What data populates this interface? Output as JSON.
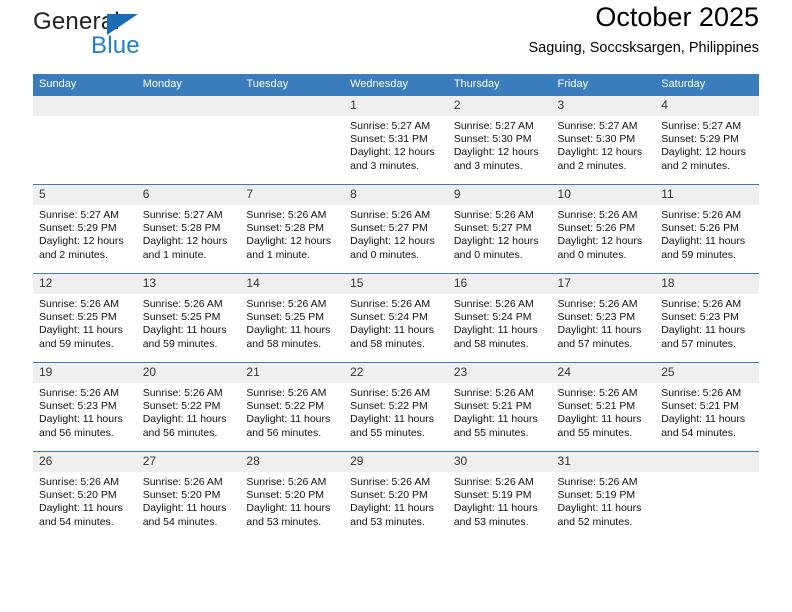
{
  "brand": {
    "line1": "General",
    "line2": "Blue",
    "triangle_color": "#1b6cb5",
    "blue_text_color": "#1b80d4"
  },
  "header": {
    "title": "October 2025",
    "subtitle": "Saguing, Soccsksargen, Philippines"
  },
  "theme": {
    "header_bar": "#3a7dbd",
    "day_band": "#efefef",
    "row_rule": "#3a7dbd"
  },
  "weekday_headers": [
    "Sunday",
    "Monday",
    "Tuesday",
    "Wednesday",
    "Thursday",
    "Friday",
    "Saturday"
  ],
  "weeks": [
    [
      {
        "day": "",
        "blank": true,
        "sunrise": "",
        "sunset": "",
        "daylight1": "",
        "daylight2": ""
      },
      {
        "day": "",
        "blank": true,
        "sunrise": "",
        "sunset": "",
        "daylight1": "",
        "daylight2": ""
      },
      {
        "day": "",
        "blank": true,
        "sunrise": "",
        "sunset": "",
        "daylight1": "",
        "daylight2": ""
      },
      {
        "day": "1",
        "sunrise": "Sunrise: 5:27 AM",
        "sunset": "Sunset: 5:31 PM",
        "daylight1": "Daylight: 12 hours",
        "daylight2": "and 3 minutes."
      },
      {
        "day": "2",
        "sunrise": "Sunrise: 5:27 AM",
        "sunset": "Sunset: 5:30 PM",
        "daylight1": "Daylight: 12 hours",
        "daylight2": "and 3 minutes."
      },
      {
        "day": "3",
        "sunrise": "Sunrise: 5:27 AM",
        "sunset": "Sunset: 5:30 PM",
        "daylight1": "Daylight: 12 hours",
        "daylight2": "and 2 minutes."
      },
      {
        "day": "4",
        "sunrise": "Sunrise: 5:27 AM",
        "sunset": "Sunset: 5:29 PM",
        "daylight1": "Daylight: 12 hours",
        "daylight2": "and 2 minutes."
      }
    ],
    [
      {
        "day": "5",
        "sunrise": "Sunrise: 5:27 AM",
        "sunset": "Sunset: 5:29 PM",
        "daylight1": "Daylight: 12 hours",
        "daylight2": "and 2 minutes."
      },
      {
        "day": "6",
        "sunrise": "Sunrise: 5:27 AM",
        "sunset": "Sunset: 5:28 PM",
        "daylight1": "Daylight: 12 hours",
        "daylight2": "and 1 minute."
      },
      {
        "day": "7",
        "sunrise": "Sunrise: 5:26 AM",
        "sunset": "Sunset: 5:28 PM",
        "daylight1": "Daylight: 12 hours",
        "daylight2": "and 1 minute."
      },
      {
        "day": "8",
        "sunrise": "Sunrise: 5:26 AM",
        "sunset": "Sunset: 5:27 PM",
        "daylight1": "Daylight: 12 hours",
        "daylight2": "and 0 minutes."
      },
      {
        "day": "9",
        "sunrise": "Sunrise: 5:26 AM",
        "sunset": "Sunset: 5:27 PM",
        "daylight1": "Daylight: 12 hours",
        "daylight2": "and 0 minutes."
      },
      {
        "day": "10",
        "sunrise": "Sunrise: 5:26 AM",
        "sunset": "Sunset: 5:26 PM",
        "daylight1": "Daylight: 12 hours",
        "daylight2": "and 0 minutes."
      },
      {
        "day": "11",
        "sunrise": "Sunrise: 5:26 AM",
        "sunset": "Sunset: 5:26 PM",
        "daylight1": "Daylight: 11 hours",
        "daylight2": "and 59 minutes."
      }
    ],
    [
      {
        "day": "12",
        "sunrise": "Sunrise: 5:26 AM",
        "sunset": "Sunset: 5:25 PM",
        "daylight1": "Daylight: 11 hours",
        "daylight2": "and 59 minutes."
      },
      {
        "day": "13",
        "sunrise": "Sunrise: 5:26 AM",
        "sunset": "Sunset: 5:25 PM",
        "daylight1": "Daylight: 11 hours",
        "daylight2": "and 59 minutes."
      },
      {
        "day": "14",
        "sunrise": "Sunrise: 5:26 AM",
        "sunset": "Sunset: 5:25 PM",
        "daylight1": "Daylight: 11 hours",
        "daylight2": "and 58 minutes."
      },
      {
        "day": "15",
        "sunrise": "Sunrise: 5:26 AM",
        "sunset": "Sunset: 5:24 PM",
        "daylight1": "Daylight: 11 hours",
        "daylight2": "and 58 minutes."
      },
      {
        "day": "16",
        "sunrise": "Sunrise: 5:26 AM",
        "sunset": "Sunset: 5:24 PM",
        "daylight1": "Daylight: 11 hours",
        "daylight2": "and 58 minutes."
      },
      {
        "day": "17",
        "sunrise": "Sunrise: 5:26 AM",
        "sunset": "Sunset: 5:23 PM",
        "daylight1": "Daylight: 11 hours",
        "daylight2": "and 57 minutes."
      },
      {
        "day": "18",
        "sunrise": "Sunrise: 5:26 AM",
        "sunset": "Sunset: 5:23 PM",
        "daylight1": "Daylight: 11 hours",
        "daylight2": "and 57 minutes."
      }
    ],
    [
      {
        "day": "19",
        "sunrise": "Sunrise: 5:26 AM",
        "sunset": "Sunset: 5:23 PM",
        "daylight1": "Daylight: 11 hours",
        "daylight2": "and 56 minutes."
      },
      {
        "day": "20",
        "sunrise": "Sunrise: 5:26 AM",
        "sunset": "Sunset: 5:22 PM",
        "daylight1": "Daylight: 11 hours",
        "daylight2": "and 56 minutes."
      },
      {
        "day": "21",
        "sunrise": "Sunrise: 5:26 AM",
        "sunset": "Sunset: 5:22 PM",
        "daylight1": "Daylight: 11 hours",
        "daylight2": "and 56 minutes."
      },
      {
        "day": "22",
        "sunrise": "Sunrise: 5:26 AM",
        "sunset": "Sunset: 5:22 PM",
        "daylight1": "Daylight: 11 hours",
        "daylight2": "and 55 minutes."
      },
      {
        "day": "23",
        "sunrise": "Sunrise: 5:26 AM",
        "sunset": "Sunset: 5:21 PM",
        "daylight1": "Daylight: 11 hours",
        "daylight2": "and 55 minutes."
      },
      {
        "day": "24",
        "sunrise": "Sunrise: 5:26 AM",
        "sunset": "Sunset: 5:21 PM",
        "daylight1": "Daylight: 11 hours",
        "daylight2": "and 55 minutes."
      },
      {
        "day": "25",
        "sunrise": "Sunrise: 5:26 AM",
        "sunset": "Sunset: 5:21 PM",
        "daylight1": "Daylight: 11 hours",
        "daylight2": "and 54 minutes."
      }
    ],
    [
      {
        "day": "26",
        "sunrise": "Sunrise: 5:26 AM",
        "sunset": "Sunset: 5:20 PM",
        "daylight1": "Daylight: 11 hours",
        "daylight2": "and 54 minutes."
      },
      {
        "day": "27",
        "sunrise": "Sunrise: 5:26 AM",
        "sunset": "Sunset: 5:20 PM",
        "daylight1": "Daylight: 11 hours",
        "daylight2": "and 54 minutes."
      },
      {
        "day": "28",
        "sunrise": "Sunrise: 5:26 AM",
        "sunset": "Sunset: 5:20 PM",
        "daylight1": "Daylight: 11 hours",
        "daylight2": "and 53 minutes."
      },
      {
        "day": "29",
        "sunrise": "Sunrise: 5:26 AM",
        "sunset": "Sunset: 5:20 PM",
        "daylight1": "Daylight: 11 hours",
        "daylight2": "and 53 minutes."
      },
      {
        "day": "30",
        "sunrise": "Sunrise: 5:26 AM",
        "sunset": "Sunset: 5:19 PM",
        "daylight1": "Daylight: 11 hours",
        "daylight2": "and 53 minutes."
      },
      {
        "day": "31",
        "sunrise": "Sunrise: 5:26 AM",
        "sunset": "Sunset: 5:19 PM",
        "daylight1": "Daylight: 11 hours",
        "daylight2": "and 52 minutes."
      },
      {
        "day": "",
        "blank": true,
        "sunrise": "",
        "sunset": "",
        "daylight1": "",
        "daylight2": ""
      }
    ]
  ]
}
